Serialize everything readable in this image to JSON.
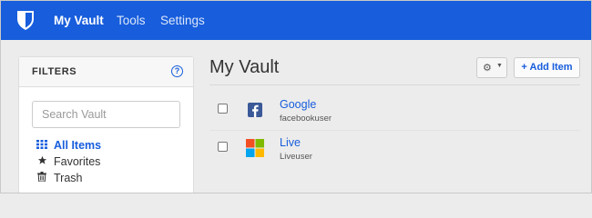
{
  "nav": {
    "logo_icon": "bitwarden-shield-icon",
    "items": [
      {
        "label": "My Vault",
        "active": true
      },
      {
        "label": "Tools",
        "active": false
      },
      {
        "label": "Settings",
        "active": false
      }
    ],
    "brand_color": "#175ddc"
  },
  "filters": {
    "title": "FILTERS",
    "help_icon_glyph": "?",
    "search": {
      "placeholder": "Search Vault",
      "value": ""
    },
    "items": [
      {
        "label": "All Items",
        "icon": "grid-icon",
        "active": true
      },
      {
        "label": "Favorites",
        "icon": "star-icon",
        "active": false
      },
      {
        "label": "Trash",
        "icon": "trash-icon",
        "active": false
      }
    ]
  },
  "main": {
    "title": "My Vault",
    "add_button": "Add Item",
    "add_icon": "plus-icon",
    "options_icon": "gear-icon",
    "items": [
      {
        "name": "Google",
        "username": "facebookuser",
        "icon": "facebook-icon",
        "checked": false
      },
      {
        "name": "Live",
        "username": "Liveuser",
        "icon": "microsoft-icon",
        "checked": false
      }
    ]
  }
}
